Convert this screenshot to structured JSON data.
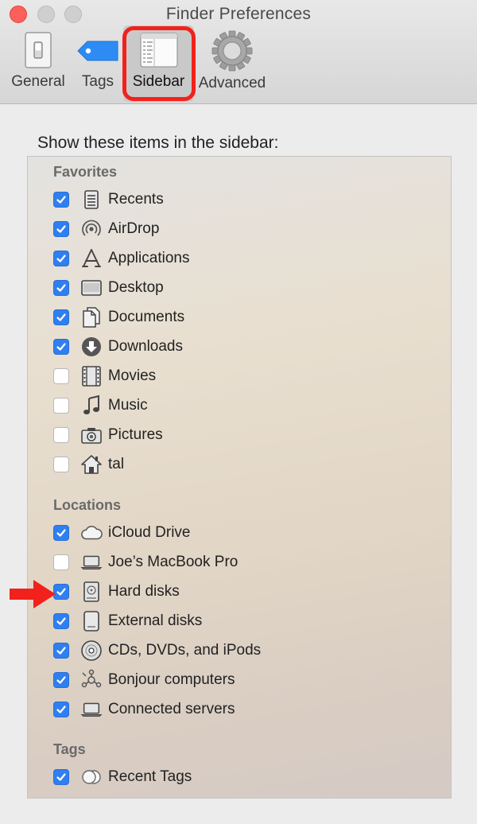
{
  "window": {
    "title": "Finder Preferences"
  },
  "toolbar": {
    "general": "General",
    "tags": "Tags",
    "sidebar": "Sidebar",
    "advanced": "Advanced",
    "selected": "sidebar"
  },
  "content": {
    "heading": "Show these items in the sidebar:"
  },
  "favorites": {
    "title": "Favorites",
    "items": [
      {
        "label": "Recents",
        "checked": true,
        "icon": "recents-icon"
      },
      {
        "label": "AirDrop",
        "checked": true,
        "icon": "airdrop-icon"
      },
      {
        "label": "Applications",
        "checked": true,
        "icon": "applications-icon"
      },
      {
        "label": "Desktop",
        "checked": true,
        "icon": "desktop-icon"
      },
      {
        "label": "Documents",
        "checked": true,
        "icon": "documents-icon"
      },
      {
        "label": "Downloads",
        "checked": true,
        "icon": "downloads-icon"
      },
      {
        "label": "Movies",
        "checked": false,
        "icon": "movies-icon"
      },
      {
        "label": "Music",
        "checked": false,
        "icon": "music-icon"
      },
      {
        "label": "Pictures",
        "checked": false,
        "icon": "pictures-icon"
      },
      {
        "label": "tal",
        "checked": false,
        "icon": "home-icon"
      }
    ]
  },
  "locations": {
    "title": "Locations",
    "items": [
      {
        "label": "iCloud Drive",
        "checked": true,
        "icon": "cloud-icon"
      },
      {
        "label": "Joe’s MacBook Pro",
        "checked": false,
        "icon": "laptop-icon"
      },
      {
        "label": "Hard disks",
        "checked": true,
        "icon": "hard-disk-icon"
      },
      {
        "label": "External disks",
        "checked": true,
        "icon": "external-disk-icon"
      },
      {
        "label": "CDs, DVDs, and iPods",
        "checked": true,
        "icon": "cd-icon"
      },
      {
        "label": "Bonjour computers",
        "checked": true,
        "icon": "bonjour-icon"
      },
      {
        "label": "Connected servers",
        "checked": true,
        "icon": "server-icon"
      }
    ]
  },
  "tags": {
    "title": "Tags",
    "items": [
      {
        "label": "Recent Tags",
        "checked": true,
        "icon": "recent-tags-icon"
      }
    ]
  },
  "colors": {
    "accent": "#2f7ff0",
    "annotation": "#f2211b",
    "close": "#fc605c"
  }
}
